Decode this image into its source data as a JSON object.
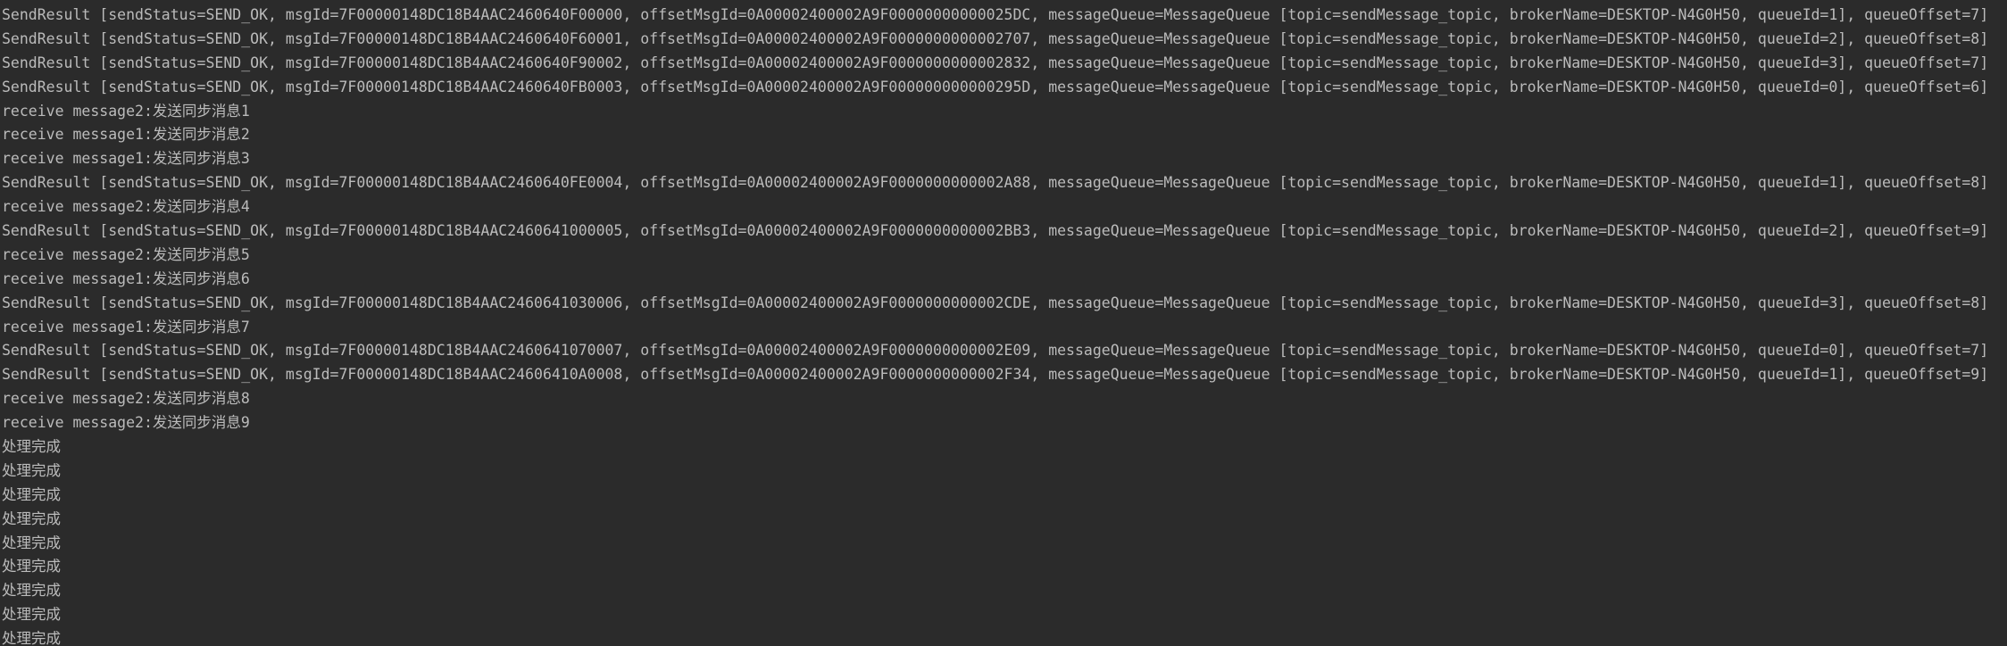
{
  "console": {
    "lines": [
      "SendResult [sendStatus=SEND_OK, msgId=7F00000148DC18B4AAC2460640F00000, offsetMsgId=0A00002400002A9F00000000000025DC, messageQueue=MessageQueue [topic=sendMessage_topic, brokerName=DESKTOP-N4G0H50, queueId=1], queueOffset=7]",
      "SendResult [sendStatus=SEND_OK, msgId=7F00000148DC18B4AAC2460640F60001, offsetMsgId=0A00002400002A9F0000000000002707, messageQueue=MessageQueue [topic=sendMessage_topic, brokerName=DESKTOP-N4G0H50, queueId=2], queueOffset=8]",
      "SendResult [sendStatus=SEND_OK, msgId=7F00000148DC18B4AAC2460640F90002, offsetMsgId=0A00002400002A9F0000000000002832, messageQueue=MessageQueue [topic=sendMessage_topic, brokerName=DESKTOP-N4G0H50, queueId=3], queueOffset=7]",
      "SendResult [sendStatus=SEND_OK, msgId=7F00000148DC18B4AAC2460640FB0003, offsetMsgId=0A00002400002A9F000000000000295D, messageQueue=MessageQueue [topic=sendMessage_topic, brokerName=DESKTOP-N4G0H50, queueId=0], queueOffset=6]",
      "receive message2:发送同步消息1",
      "receive message1:发送同步消息2",
      "receive message1:发送同步消息3",
      "SendResult [sendStatus=SEND_OK, msgId=7F00000148DC18B4AAC2460640FE0004, offsetMsgId=0A00002400002A9F0000000000002A88, messageQueue=MessageQueue [topic=sendMessage_topic, brokerName=DESKTOP-N4G0H50, queueId=1], queueOffset=8]",
      "receive message2:发送同步消息4",
      "SendResult [sendStatus=SEND_OK, msgId=7F00000148DC18B4AAC2460641000005, offsetMsgId=0A00002400002A9F0000000000002BB3, messageQueue=MessageQueue [topic=sendMessage_topic, brokerName=DESKTOP-N4G0H50, queueId=2], queueOffset=9]",
      "receive message2:发送同步消息5",
      "receive message1:发送同步消息6",
      "SendResult [sendStatus=SEND_OK, msgId=7F00000148DC18B4AAC2460641030006, offsetMsgId=0A00002400002A9F0000000000002CDE, messageQueue=MessageQueue [topic=sendMessage_topic, brokerName=DESKTOP-N4G0H50, queueId=3], queueOffset=8]",
      "receive message1:发送同步消息7",
      "SendResult [sendStatus=SEND_OK, msgId=7F00000148DC18B4AAC2460641070007, offsetMsgId=0A00002400002A9F0000000000002E09, messageQueue=MessageQueue [topic=sendMessage_topic, brokerName=DESKTOP-N4G0H50, queueId=0], queueOffset=7]",
      "SendResult [sendStatus=SEND_OK, msgId=7F00000148DC18B4AAC24606410A0008, offsetMsgId=0A00002400002A9F0000000000002F34, messageQueue=MessageQueue [topic=sendMessage_topic, brokerName=DESKTOP-N4G0H50, queueId=1], queueOffset=9]",
      "receive message2:发送同步消息8",
      "receive message2:发送同步消息9",
      "处理完成",
      "处理完成",
      "处理完成",
      "处理完成",
      "处理完成",
      "处理完成",
      "处理完成",
      "处理完成",
      "处理完成"
    ]
  },
  "colors": {
    "background": "#2b2b2b",
    "text": "#bbbbbb"
  }
}
